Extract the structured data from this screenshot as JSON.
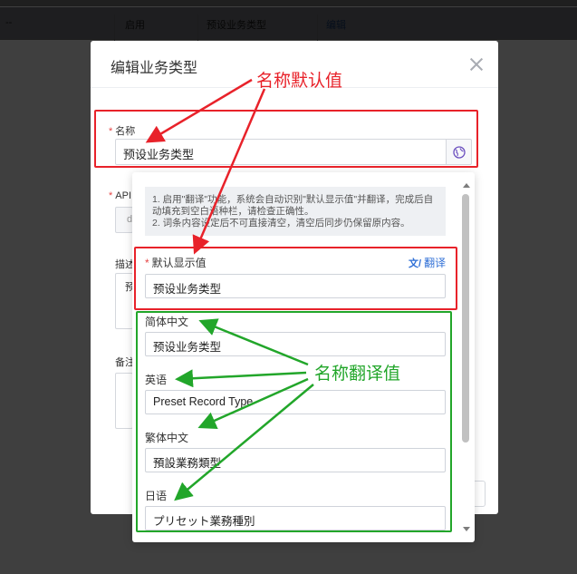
{
  "background_table": {
    "row": {
      "col1": "--",
      "col2": "启用",
      "col3": "预设业务类型",
      "action": "编辑"
    }
  },
  "dialog": {
    "title": "编辑业务类型",
    "name_field": {
      "label": "名称",
      "value": "预设业务类型"
    },
    "api_label": "API",
    "api_value": "d",
    "desc_label": "描述",
    "desc_value": "预",
    "remark_label": "备注"
  },
  "translation_popover": {
    "notice_line1": "1. 启用\"翻译\"功能，系统会自动识别\"默认显示值\"并翻译，完成后自",
    "notice_line2": "动填充到空白语种栏，请检查正确性。",
    "notice_line3": "2. 词条内容设定后不可直接清空，清空后同步仍保留原内容。",
    "default_label": "默认显示值",
    "translate_label": "翻译",
    "default_value": "预设业务类型",
    "languages": [
      {
        "label": "简体中文",
        "value": "预设业务类型"
      },
      {
        "label": "英语",
        "value": "Preset Record Type"
      },
      {
        "label": "繁体中文",
        "value": "預設業務類型"
      },
      {
        "label": "日语",
        "value": "プリセット業務種別"
      }
    ]
  },
  "annotations": {
    "default_value_note": "名称默认值",
    "translation_note": "名称翻译值"
  },
  "colors": {
    "annotation_red": "#e8222a",
    "annotation_green": "#22a62a",
    "link_blue": "#2f6fd6"
  }
}
